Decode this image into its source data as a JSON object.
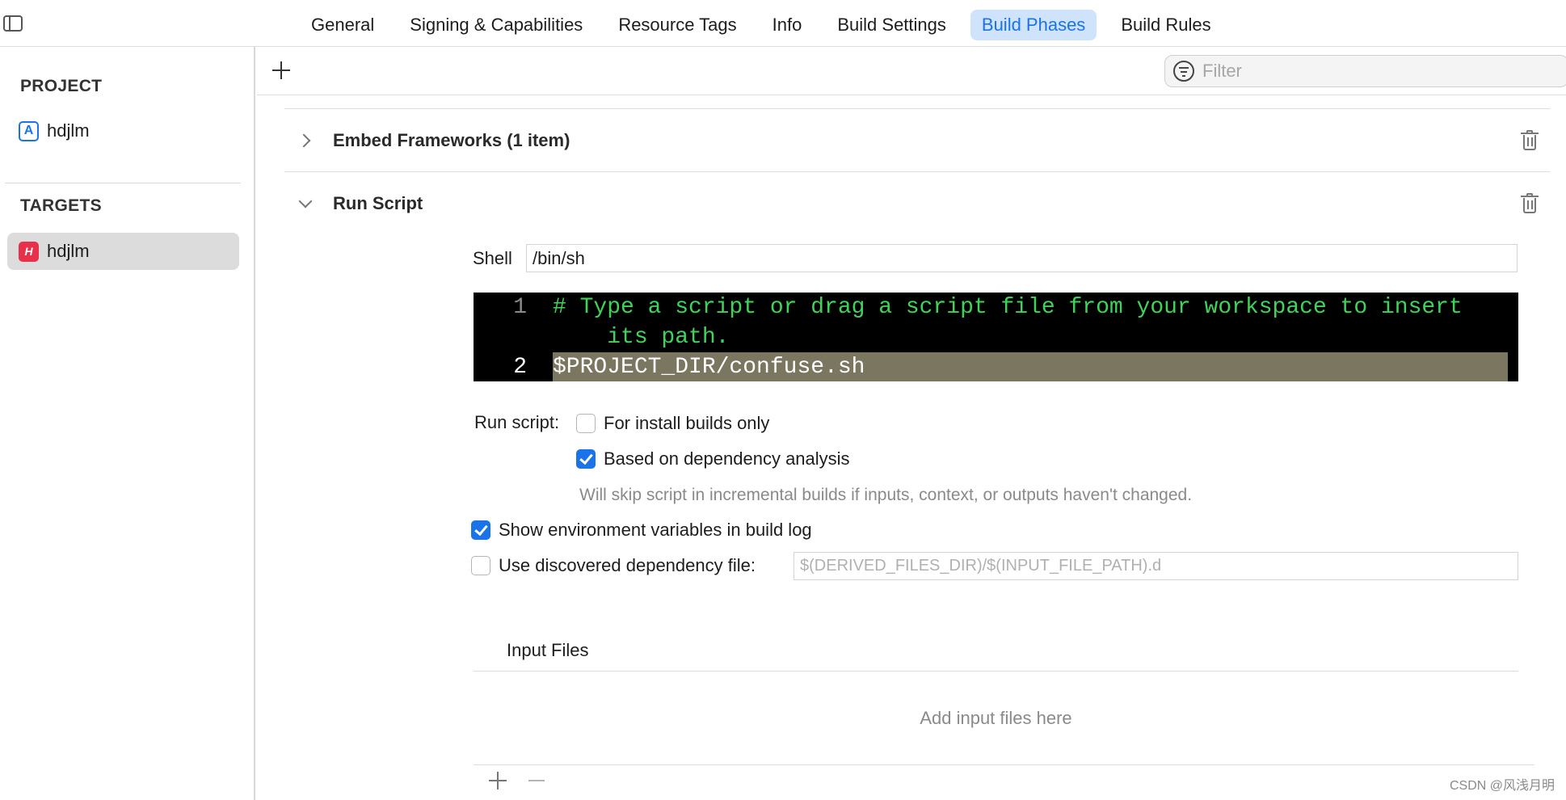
{
  "tabs": [
    {
      "label": "General",
      "active": false
    },
    {
      "label": "Signing & Capabilities",
      "active": false
    },
    {
      "label": "Resource Tags",
      "active": false
    },
    {
      "label": "Info",
      "active": false
    },
    {
      "label": "Build Settings",
      "active": false
    },
    {
      "label": "Build Phases",
      "active": true
    },
    {
      "label": "Build Rules",
      "active": false
    }
  ],
  "sidebar": {
    "project_heading": "PROJECT",
    "project_item": "hdjlm",
    "targets_heading": "TARGETS",
    "target_item": "hdjlm"
  },
  "toolbar": {
    "filter_placeholder": "Filter"
  },
  "phases": {
    "embed_frameworks": {
      "title": "Embed Frameworks (1 item)",
      "expanded": false
    },
    "run_script": {
      "title": "Run Script",
      "expanded": true
    }
  },
  "run_script": {
    "shell_label": "Shell",
    "shell_value": "/bin/sh",
    "code": [
      {
        "num": "1",
        "text": "# Type a script or drag a script file from your workspace to insert"
      },
      {
        "num": "",
        "text": "    its path."
      },
      {
        "num": "2",
        "text": "$PROJECT_DIR/confuse.sh"
      }
    ],
    "run_script_label": "Run script:",
    "install_builds_only": {
      "label": "For install builds only",
      "checked": false
    },
    "dependency_analysis": {
      "label": "Based on dependency analysis",
      "checked": true
    },
    "dependency_hint": "Will skip script in incremental builds if inputs, context, or outputs haven't changed.",
    "show_env_vars": {
      "label": "Show environment variables in build log",
      "checked": true
    },
    "discovered_dep_file": {
      "label": "Use discovered dependency file:",
      "checked": false
    },
    "dep_file_placeholder": "$(DERIVED_FILES_DIR)/$(INPUT_FILE_PATH).d",
    "input_files_heading": "Input Files",
    "add_input_files_hint": "Add input files here"
  },
  "watermark": "CSDN @风浅月明",
  "colors": {
    "accent": "#1a73e8",
    "active_tab_bg": "#cfe3fb",
    "editor_bg": "#000000",
    "comment_green": "#3fd35c",
    "highlight_line": "#7a7660"
  }
}
